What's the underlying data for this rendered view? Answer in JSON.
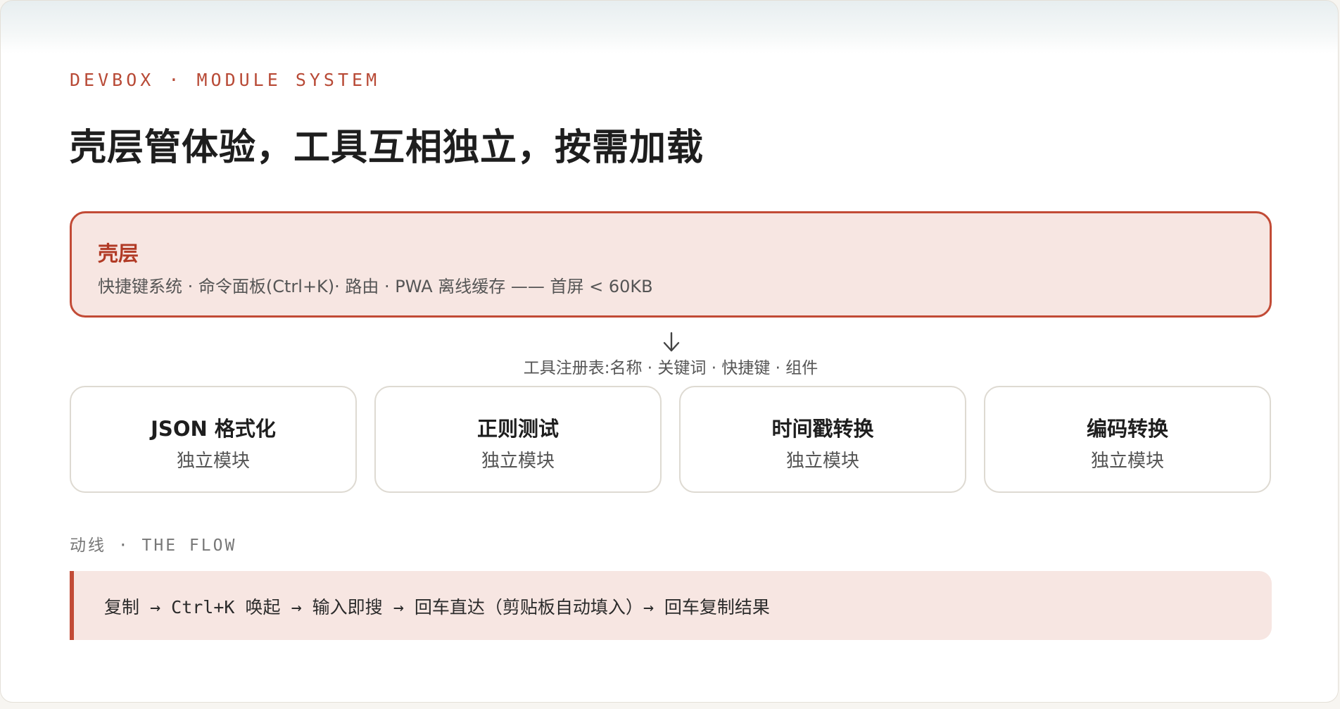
{
  "eyebrow": "DEVBOX · MODULE SYSTEM",
  "headline": "壳层管体验，工具互相独立，按需加载",
  "shell": {
    "title": "壳层",
    "description": "快捷键系统 · 命令面板(Ctrl+K)· 路由 · PWA 离线缓存 —— 首屏 < 60KB"
  },
  "arrow_icon": "arrow-down-icon",
  "registry": "工具注册表:名称 · 关键词 · 快捷键 · 组件",
  "tools": [
    {
      "name": "JSON 格式化",
      "subtitle": "独立模块"
    },
    {
      "name": "正则测试",
      "subtitle": "独立模块"
    },
    {
      "name": "时间戳转换",
      "subtitle": "独立模块"
    },
    {
      "name": "编码转换",
      "subtitle": "独立模块"
    }
  ],
  "flow": {
    "label": "动线 · THE FLOW",
    "text": "复制 → Ctrl+K 唤起 → 输入即搜 → 回车直达（剪贴板自动填入）→ 回车复制结果"
  },
  "colors": {
    "accent": "#c24b36",
    "accent_bg": "#f7e6e2",
    "text": "#1e1e1e",
    "muted": "#555555"
  }
}
